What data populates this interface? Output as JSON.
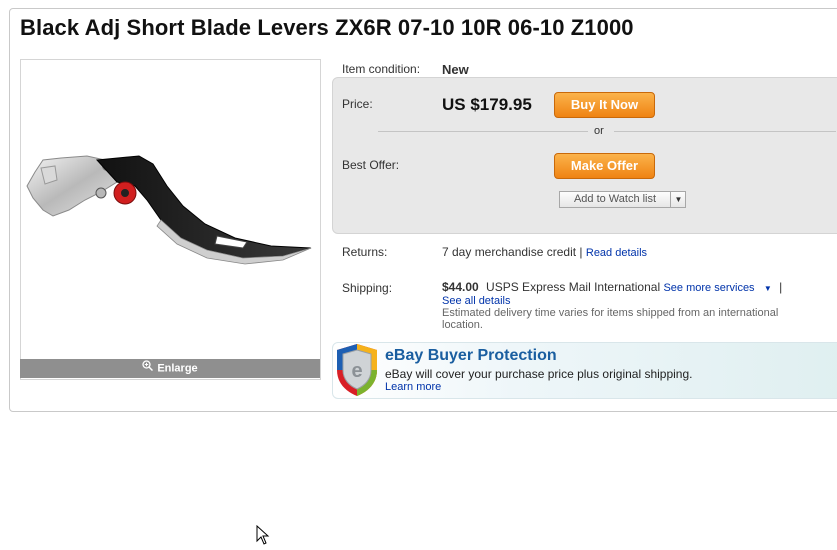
{
  "title": "Black Adj Short Blade Levers ZX6R 07-10 10R 06-10 Z1000",
  "image": {
    "enlarge_label": "Enlarge"
  },
  "condition": {
    "label": "Item condition:",
    "value": "New"
  },
  "price": {
    "label": "Price:",
    "value": "US $179.95",
    "buy_label": "Buy It Now"
  },
  "or_text": "or",
  "offer": {
    "label": "Best Offer:",
    "button_label": "Make Offer"
  },
  "watch": {
    "label": "Add to Watch list"
  },
  "returns": {
    "label": "Returns:",
    "text": "7 day merchandise credit |",
    "link": "Read details"
  },
  "shipping": {
    "label": "Shipping:",
    "cost": "$44.00",
    "service": "USPS Express Mail International",
    "more_services": "See more services",
    "separator": "|",
    "all_details": "See all details",
    "note_line1": "Estimated delivery time varies for items shipped from an international",
    "note_line2": "location."
  },
  "protection": {
    "title": "eBay Buyer Protection",
    "text": "eBay will cover your purchase price plus original shipping.",
    "link": "Learn more"
  },
  "colors": {
    "buy_button": "#f0891a",
    "link": "#0033aa",
    "protection_title": "#1a5ea0"
  }
}
